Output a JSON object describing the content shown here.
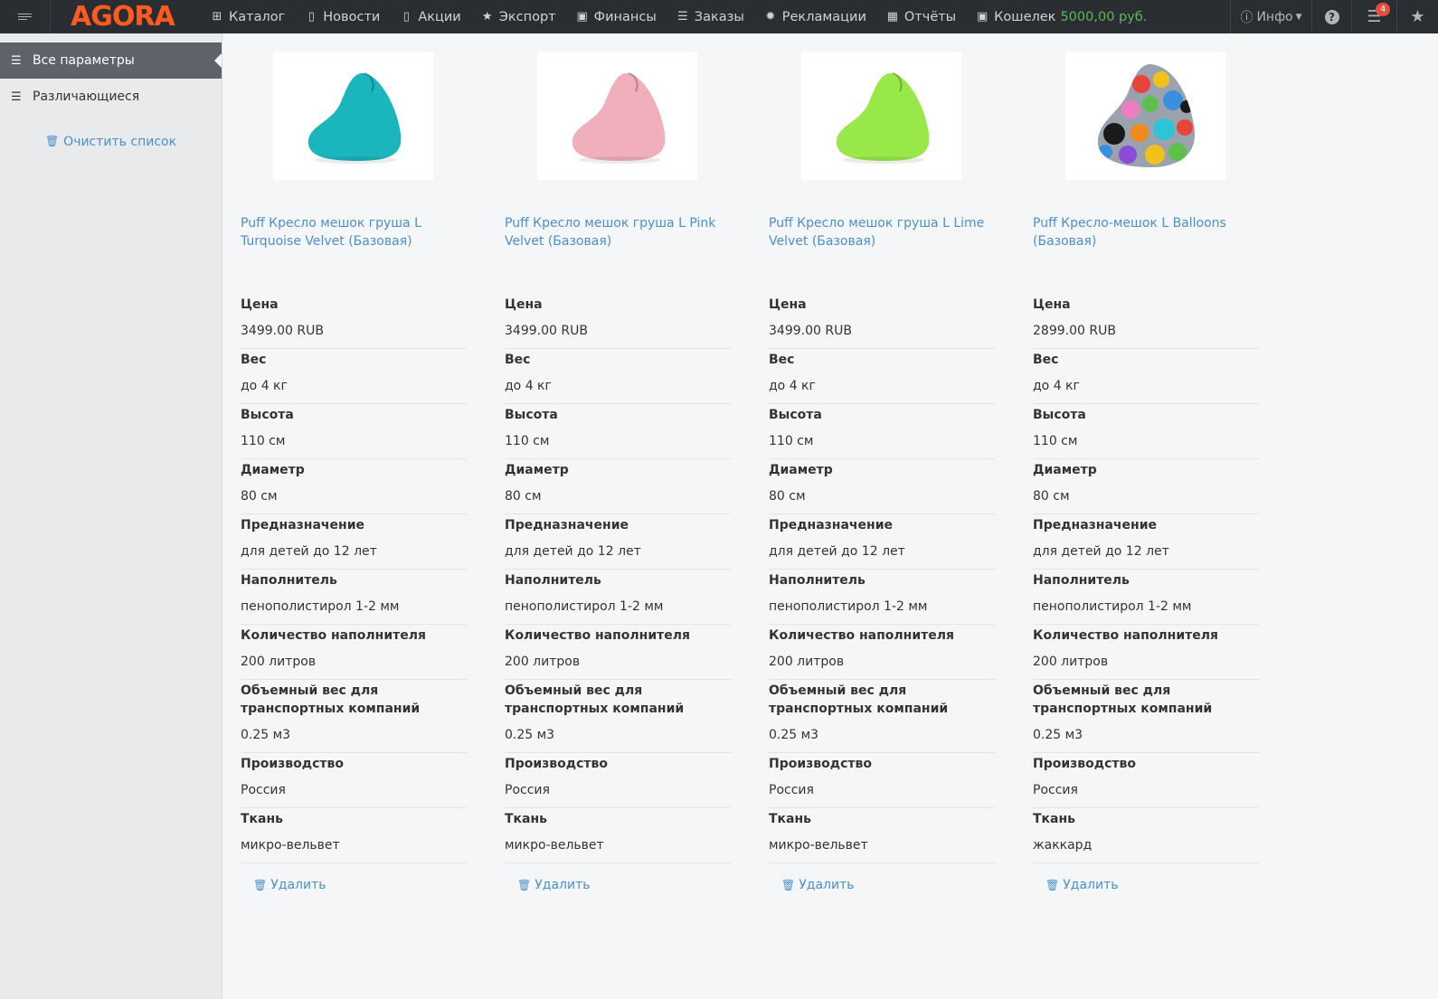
{
  "nav": {
    "logo": "AGORA",
    "items": [
      {
        "icon": "sitemap-icon",
        "glyph": "⊞",
        "label": "Каталог"
      },
      {
        "icon": "document-icon",
        "glyph": "▯",
        "label": "Новости"
      },
      {
        "icon": "document-icon",
        "glyph": "▯",
        "label": "Акции"
      },
      {
        "icon": "star-icon",
        "glyph": "★",
        "label": "Экспорт"
      },
      {
        "icon": "money-icon",
        "glyph": "▣",
        "label": "Финансы"
      },
      {
        "icon": "list-icon",
        "glyph": "☰",
        "label": "Заказы"
      },
      {
        "icon": "gear-icon",
        "glyph": "✹",
        "label": "Рекламации"
      },
      {
        "icon": "table-icon",
        "glyph": "▦",
        "label": "Отчёты"
      }
    ],
    "wallet": {
      "label": "Кошелек",
      "amount": "5000,00 руб."
    },
    "info_label": "Инфо",
    "badge_count": "4"
  },
  "sidebar": {
    "items": [
      {
        "label": "Все параметры",
        "active": true
      },
      {
        "label": "Различающиеся",
        "active": false
      }
    ],
    "clear_label": "Очистить список"
  },
  "products": [
    {
      "title": "Puff Кресло мешок груша L Turquoise Velvet (Базовая)",
      "color": "#1bb5bd",
      "params": [
        {
          "label": "Цена",
          "value": "3499.00 RUB"
        },
        {
          "label": "Вес",
          "value": "до 4 кг"
        },
        {
          "label": "Высота",
          "value": "110 см"
        },
        {
          "label": "Диаметр",
          "value": "80 см"
        },
        {
          "label": "Предназначение",
          "value": "для детей до 12 лет"
        },
        {
          "label": "Наполнитель",
          "value": "пенополистирол 1-2 мм"
        },
        {
          "label": "Количество наполнителя",
          "value": "200 литров"
        },
        {
          "label": "Объемный вес для транспортных компаний",
          "value": "0.25 м3"
        },
        {
          "label": "Производство",
          "value": "Россия"
        },
        {
          "label": "Ткань",
          "value": "микро-вельвет"
        }
      ],
      "delete_label": "Удалить"
    },
    {
      "title": "Puff Кресло мешок груша L Pink Velvet (Базовая)",
      "color": "#f1aebb",
      "params": [
        {
          "label": "Цена",
          "value": "3499.00 RUB"
        },
        {
          "label": "Вес",
          "value": "до 4 кг"
        },
        {
          "label": "Высота",
          "value": "110 см"
        },
        {
          "label": "Диаметр",
          "value": "80 см"
        },
        {
          "label": "Предназначение",
          "value": "для детей до 12 лет"
        },
        {
          "label": "Наполнитель",
          "value": "пенополистирол 1-2 мм"
        },
        {
          "label": "Количество наполнителя",
          "value": "200 литров"
        },
        {
          "label": "Объемный вес для транспортных компаний",
          "value": "0.25 м3"
        },
        {
          "label": "Производство",
          "value": "Россия"
        },
        {
          "label": "Ткань",
          "value": "микро-вельвет"
        }
      ],
      "delete_label": "Удалить"
    },
    {
      "title": "Puff Кресло мешок груша L Lime Velvet (Базовая)",
      "color": "#98e84a",
      "params": [
        {
          "label": "Цена",
          "value": "3499.00 RUB"
        },
        {
          "label": "Вес",
          "value": "до 4 кг"
        },
        {
          "label": "Высота",
          "value": "110 см"
        },
        {
          "label": "Диаметр",
          "value": "80 см"
        },
        {
          "label": "Предназначение",
          "value": "для детей до 12 лет"
        },
        {
          "label": "Наполнитель",
          "value": "пенополистирол 1-2 мм"
        },
        {
          "label": "Количество наполнителя",
          "value": "200 литров"
        },
        {
          "label": "Объемный вес для транспортных компаний",
          "value": "0.25 м3"
        },
        {
          "label": "Производство",
          "value": "Россия"
        },
        {
          "label": "Ткань",
          "value": "микро-вельвет"
        }
      ],
      "delete_label": "Удалить"
    },
    {
      "title": "Puff Кресло-мешок L Balloons (Базовая)",
      "color": "#888888",
      "params": [
        {
          "label": "Цена",
          "value": "2899.00 RUB"
        },
        {
          "label": "Вес",
          "value": "до 4 кг"
        },
        {
          "label": "Высота",
          "value": "110 см"
        },
        {
          "label": "Диаметр",
          "value": "80 см"
        },
        {
          "label": "Предназначение",
          "value": "для детей до 12 лет"
        },
        {
          "label": "Наполнитель",
          "value": "пенополистирол 1-2 мм"
        },
        {
          "label": "Количество наполнителя",
          "value": "200 литров"
        },
        {
          "label": "Объемный вес для транспортных компаний",
          "value": "0.25 м3"
        },
        {
          "label": "Производство",
          "value": "Россия"
        },
        {
          "label": "Ткань",
          "value": "жаккард"
        }
      ],
      "delete_label": "Удалить"
    }
  ]
}
